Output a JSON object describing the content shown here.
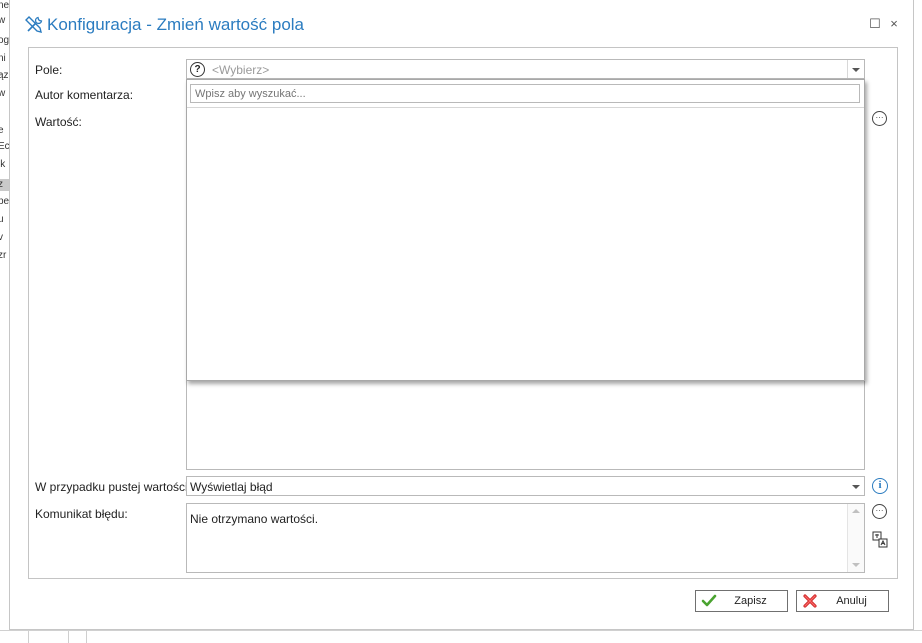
{
  "background": {
    "fragments": [
      "ne",
      "w",
      "og",
      "ni",
      "ąz",
      "w",
      "e",
      "Ec",
      "ik",
      "z",
      "pe",
      "u",
      "v",
      "zr"
    ]
  },
  "dialog": {
    "title": "Konfiguracja - Zmień wartość pola",
    "title_color": "#2b7cc0",
    "maximize_glyph": "☐",
    "close_glyph": "×"
  },
  "form": {
    "field_label": "Pole:",
    "field_placeholder": "<Wybierz>",
    "author_label": "Autor komentarza:",
    "value_label": "Wartość:",
    "search_placeholder": "Wpisz aby wyszukać...",
    "empty_value_label": "W przypadku pustej wartości:",
    "empty_value_selected": "Wyświetlaj błąd",
    "error_message_label": "Komunikat błędu:",
    "error_message_value": "Nie otrzymano wartości.",
    "help_glyph": "?",
    "info_glyph": "i",
    "dots_glyph": "···"
  },
  "buttons": {
    "save_label": "Zapisz",
    "cancel_label": "Anuluj"
  },
  "icons": {
    "title": "tools-icon",
    "help": "question-circle-icon",
    "info": "info-icon",
    "more": "more-options-icon",
    "translate": "translate-icon",
    "save": "checkmark-icon",
    "cancel": "cancel-x-icon"
  }
}
